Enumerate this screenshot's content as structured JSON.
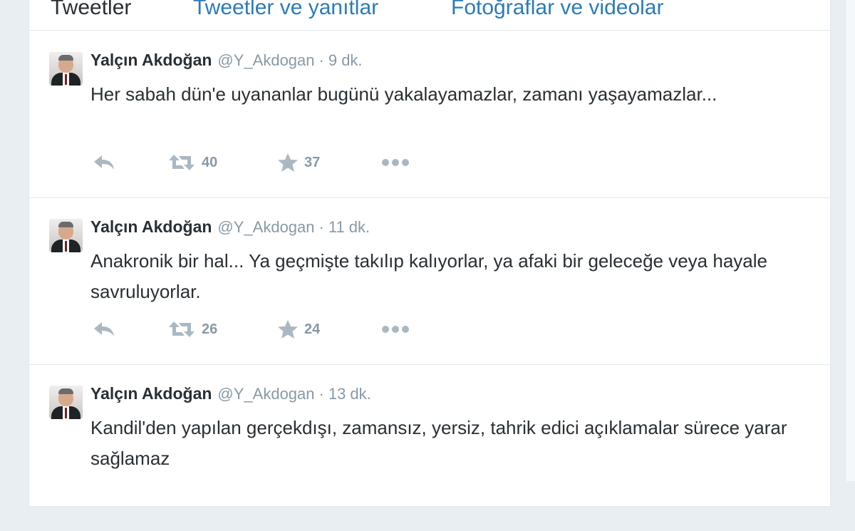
{
  "tabs": [
    {
      "label": "Tweetler"
    },
    {
      "label": "Tweetler ve yanıtlar"
    },
    {
      "label": "Fotoğraflar ve videolar"
    }
  ],
  "tweets": [
    {
      "name": "Yalçın Akdoğan",
      "handle": "@Y_Akdogan",
      "separator": "·",
      "time": "9 dk.",
      "text": "Her sabah dün'e uyananlar bugünü yakalayamazlar, zamanı yaşayamazlar...",
      "retweets": "40",
      "favorites": "37"
    },
    {
      "name": "Yalçın Akdoğan",
      "handle": "@Y_Akdogan",
      "separator": "·",
      "time": "11 dk.",
      "text": "Anakronik bir hal... Ya geçmişte takılıp kalıyorlar, ya afaki bir geleceğe veya hayale savruluyorlar.",
      "retweets": "26",
      "favorites": "24"
    },
    {
      "name": "Yalçın Akdoğan",
      "handle": "@Y_Akdogan",
      "separator": "·",
      "time": "13 dk.",
      "text": "Kandil'den yapılan gerçekdışı, zamansız, yersiz, tahrik edici açıklamalar sürece yarar sağlamaz"
    }
  ],
  "icons": {
    "reply": "reply-icon",
    "retweet": "retweet-icon",
    "favorite": "star-icon",
    "more": "more-icon"
  },
  "colors": {
    "link": "#2b7bb9",
    "text": "#292f33",
    "muted": "#8899a6",
    "icon": "#aab8c2",
    "border": "#e1e8ed"
  }
}
